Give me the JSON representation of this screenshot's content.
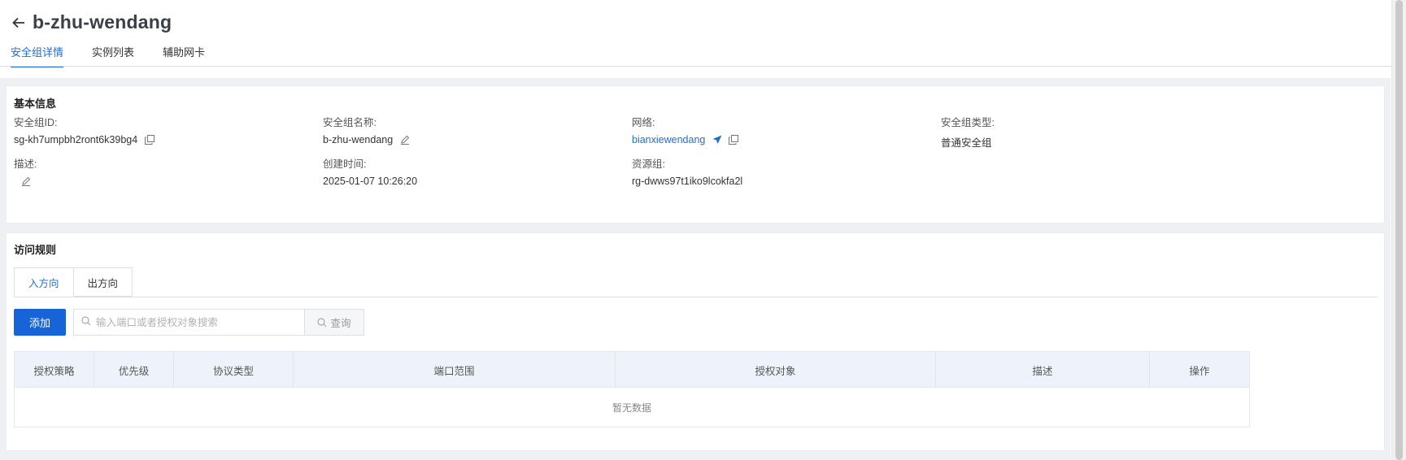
{
  "header": {
    "title": "b-zhu-wendang",
    "tabs": [
      {
        "label": "安全组详情",
        "active": true
      },
      {
        "label": "实例列表",
        "active": false
      },
      {
        "label": "辅助网卡",
        "active": false
      }
    ]
  },
  "basic_info": {
    "title": "基本信息",
    "group_id_label": "安全组ID:",
    "group_id": "sg-kh7umpbh2ront6k39bg4",
    "group_name_label": "安全组名称:",
    "group_name": "b-zhu-wendang",
    "network_label": "网络:",
    "network": "bianxiewendang",
    "type_label": "安全组类型:",
    "type": "普通安全组",
    "desc_label": "描述:",
    "created_label": "创建时间:",
    "created": "2025-01-07 10:26:20",
    "resource_group_label": "资源组:",
    "resource_group": "rg-dwws97t1iko9lcokfa2l"
  },
  "rules": {
    "title": "访问规则",
    "tabs": [
      {
        "label": "入方向",
        "active": true
      },
      {
        "label": "出方向",
        "active": false
      }
    ],
    "add_label": "添加",
    "search_placeholder": "输入端口或者授权对象搜索",
    "query_label": "查询",
    "columns": [
      "授权策略",
      "优先级",
      "协议类型",
      "端口范围",
      "授权对象",
      "描述",
      "操作"
    ],
    "empty_text": "暂无数据"
  },
  "colors": {
    "accent": "#1f6fd1",
    "primary_button": "#1764d8",
    "table_header_bg": "#eef3fb",
    "page_bg": "#eef0f3"
  },
  "icons": [
    "arrow-left-icon",
    "copy-icon",
    "edit-icon",
    "send-icon",
    "search-icon"
  ]
}
